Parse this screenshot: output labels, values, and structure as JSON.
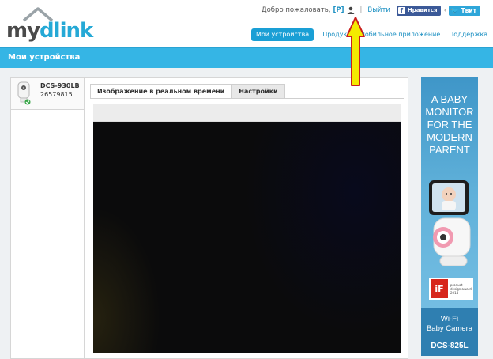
{
  "header": {
    "logo": {
      "part1": "my",
      "part2": "dlink"
    },
    "welcome": "Добро пожаловать,",
    "user": "[P]",
    "logout": "Выйти",
    "facebook": "Нравится",
    "twitter": "Твит",
    "nav": [
      {
        "label": "Мои устройства",
        "active": true
      },
      {
        "label": "Продукт"
      },
      {
        "label": "Мобильное приложение"
      },
      {
        "label": "Поддержка"
      }
    ]
  },
  "page_title": "Мои устройства",
  "device": {
    "name": "DCS-930LB",
    "id": "26579815"
  },
  "tabs": [
    {
      "label": "Изображение в реальном времени",
      "active": true
    },
    {
      "label": "Настройки"
    }
  ],
  "ad": {
    "headline": [
      "A BABY",
      "MONITOR",
      "FOR THE",
      "MODERN",
      "PARENT"
    ],
    "award": "iF",
    "award_text": [
      "product",
      "design award",
      "2014"
    ],
    "wifi_line1": "Wi-Fi",
    "wifi_line2": "Baby Camera",
    "model": "DCS-825L"
  },
  "colors": {
    "brand_blue": "#35b5e5",
    "link": "#1a8fc2",
    "arrow": "#f2e600"
  }
}
